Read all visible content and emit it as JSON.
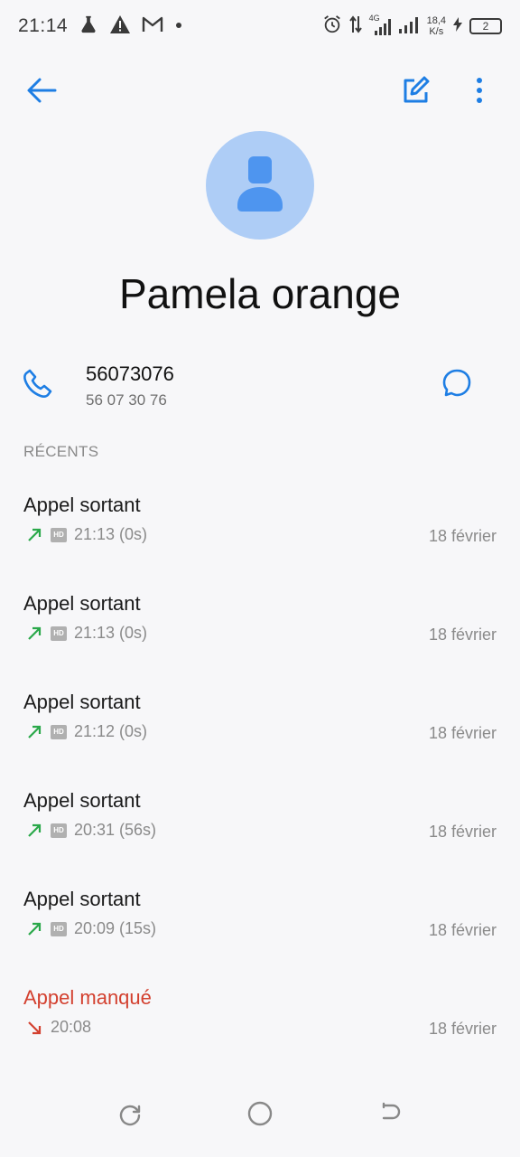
{
  "status_bar": {
    "time": "21:14",
    "speed_value": "18,4",
    "speed_unit": "K/s",
    "network": "4G",
    "battery": "2"
  },
  "topbar": {
    "back_icon": "arrow-left-icon",
    "edit_icon": "edit-icon",
    "more_icon": "more-vert-icon"
  },
  "contact": {
    "name": "Pamela orange",
    "avatar_icon": "person-icon",
    "phone_number": "56073076",
    "phone_formatted": "56 07 30 76"
  },
  "recents": {
    "title": "RÉCENTS",
    "calls": [
      {
        "type": "Appel sortant",
        "time": "21:13 (0s)",
        "date": "18 février",
        "direction": "outgoing",
        "hd": true
      },
      {
        "type": "Appel sortant",
        "time": "21:13 (0s)",
        "date": "18 février",
        "direction": "outgoing",
        "hd": true
      },
      {
        "type": "Appel sortant",
        "time": "21:12 (0s)",
        "date": "18 février",
        "direction": "outgoing",
        "hd": true
      },
      {
        "type": "Appel sortant",
        "time": "20:31 (56s)",
        "date": "18 février",
        "direction": "outgoing",
        "hd": true
      },
      {
        "type": "Appel sortant",
        "time": "20:09 (15s)",
        "date": "18 février",
        "direction": "outgoing",
        "hd": true
      },
      {
        "type": "Appel manqué",
        "time": "20:08",
        "date": "18 février",
        "direction": "missed",
        "hd": false
      }
    ]
  },
  "colors": {
    "accent": "#1e7ee4",
    "outgoing": "#2aa84a",
    "missed": "#d3402f",
    "avatar_bg": "#aecdf6"
  },
  "hd_label": "HD",
  "nav": {
    "recents_icon": "recents-icon",
    "home_icon": "home-circle-icon",
    "back_icon": "nav-back-icon"
  }
}
